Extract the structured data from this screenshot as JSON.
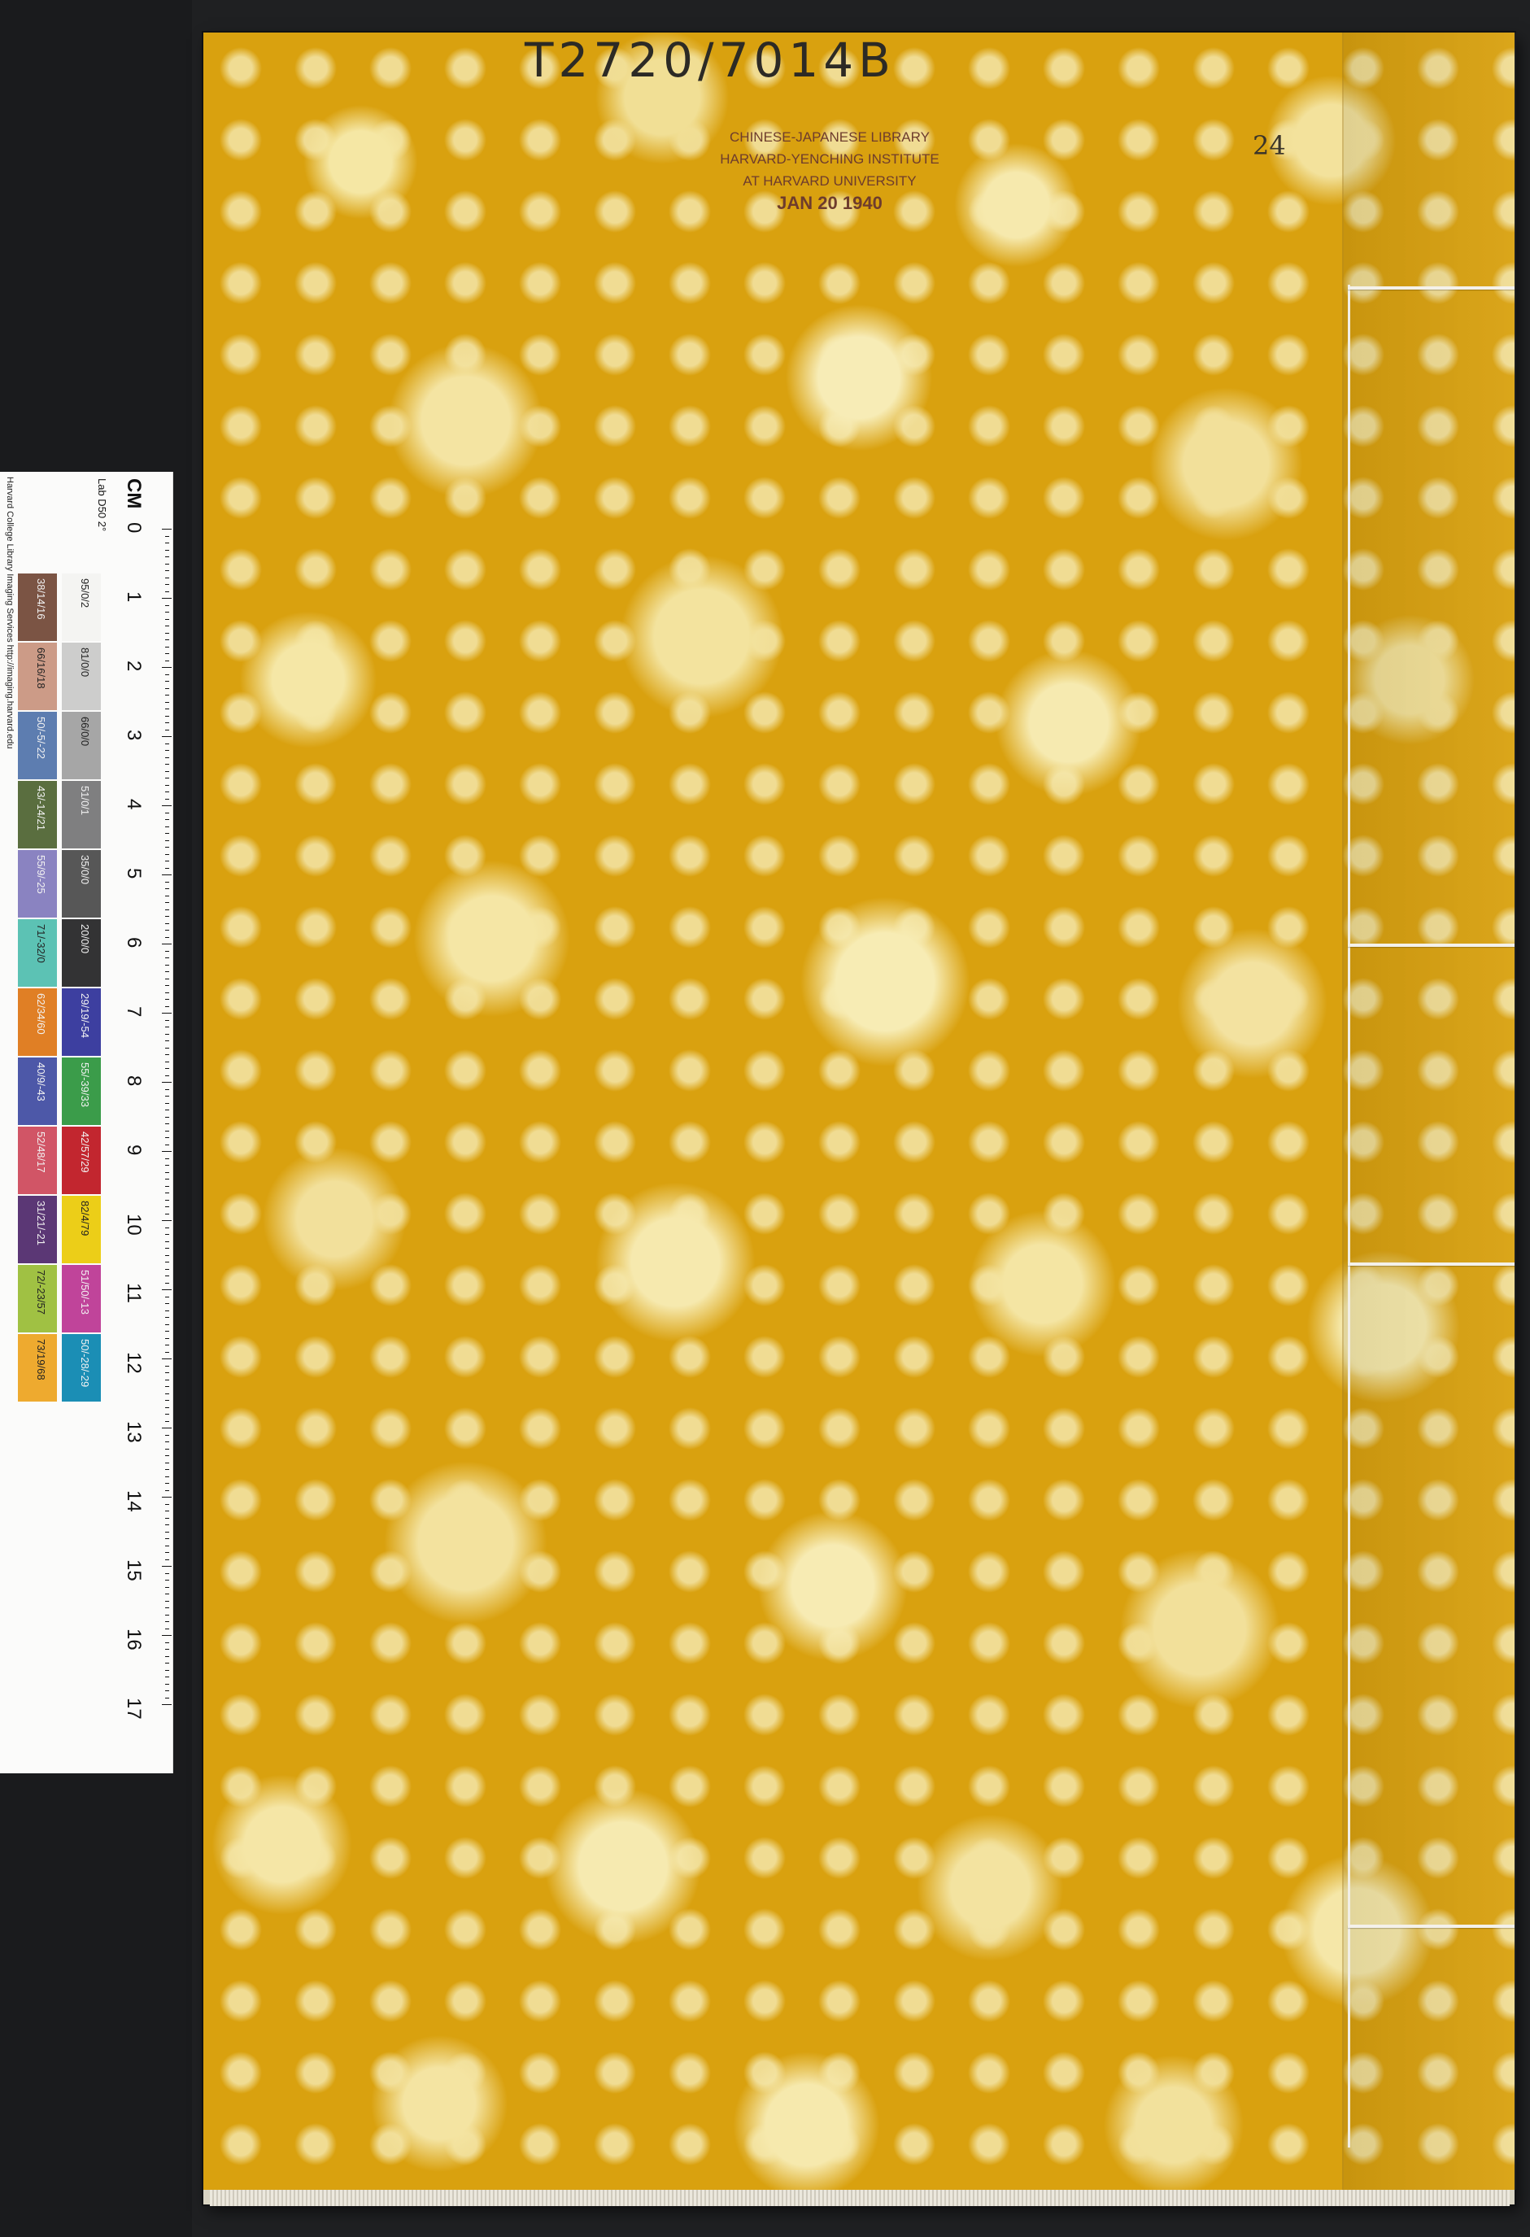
{
  "cover": {
    "call_number": "T2720/7014B",
    "stamp_lines": [
      "CHINESE-JAPANESE LIBRARY",
      "HARVARD-YENCHING INSTITUTE",
      "AT HARVARD UNIVERSITY",
      "JAN 20 1940"
    ],
    "volume_number": "24",
    "thread_bindings": 4
  },
  "target": {
    "credit": "Harvard College Library Imaging Services http://imaging.harvard.edu",
    "cm_label": "CM",
    "lab_label": "Lab D50 2°",
    "cm_numbers": [
      "0",
      "1",
      "2",
      "3",
      "4",
      "5",
      "6",
      "7",
      "8",
      "9",
      "10",
      "11",
      "12",
      "13",
      "14",
      "15",
      "16",
      "17"
    ],
    "gray_swatches": [
      {
        "label": "95/0/2",
        "color": "#f4f4f2"
      },
      {
        "label": "81/0/0",
        "color": "#cdcdcc"
      },
      {
        "label": "66/0/0",
        "color": "#a6a6a6"
      },
      {
        "label": "51/0/1",
        "color": "#7f7f80"
      },
      {
        "label": "35/0/0",
        "color": "#575757"
      },
      {
        "label": "20/0/0",
        "color": "#333334"
      },
      {
        "label": "29/19/-54",
        "color": "#3d3fa0"
      },
      {
        "label": "55/-39/33",
        "color": "#3b9c4a"
      },
      {
        "label": "42/57/29",
        "color": "#c2262f"
      },
      {
        "label": "82/4/79",
        "color": "#ecce18"
      },
      {
        "label": "51/50/-13",
        "color": "#c0449a"
      },
      {
        "label": "50/-28/-29",
        "color": "#1b8eb5"
      }
    ],
    "color_swatches": [
      {
        "label": "38/14/16",
        "color": "#7b5444"
      },
      {
        "label": "66/16/18",
        "color": "#cc9b87"
      },
      {
        "label": "50/-5/-22",
        "color": "#5d7db0"
      },
      {
        "label": "43/-14/21",
        "color": "#5a6e3f"
      },
      {
        "label": "55/9/-25",
        "color": "#8a83c1"
      },
      {
        "label": "71/-32/0",
        "color": "#5cc2b4"
      },
      {
        "label": "62/34/60",
        "color": "#e07f25"
      },
      {
        "label": "40/9/-43",
        "color": "#4d58a8"
      },
      {
        "label": "52/48/17",
        "color": "#d15566"
      },
      {
        "label": "31/21/-21",
        "color": "#5b3775"
      },
      {
        "label": "72/-23/57",
        "color": "#a0c143"
      },
      {
        "label": "73/19/68",
        "color": "#eeaa2f"
      }
    ]
  }
}
